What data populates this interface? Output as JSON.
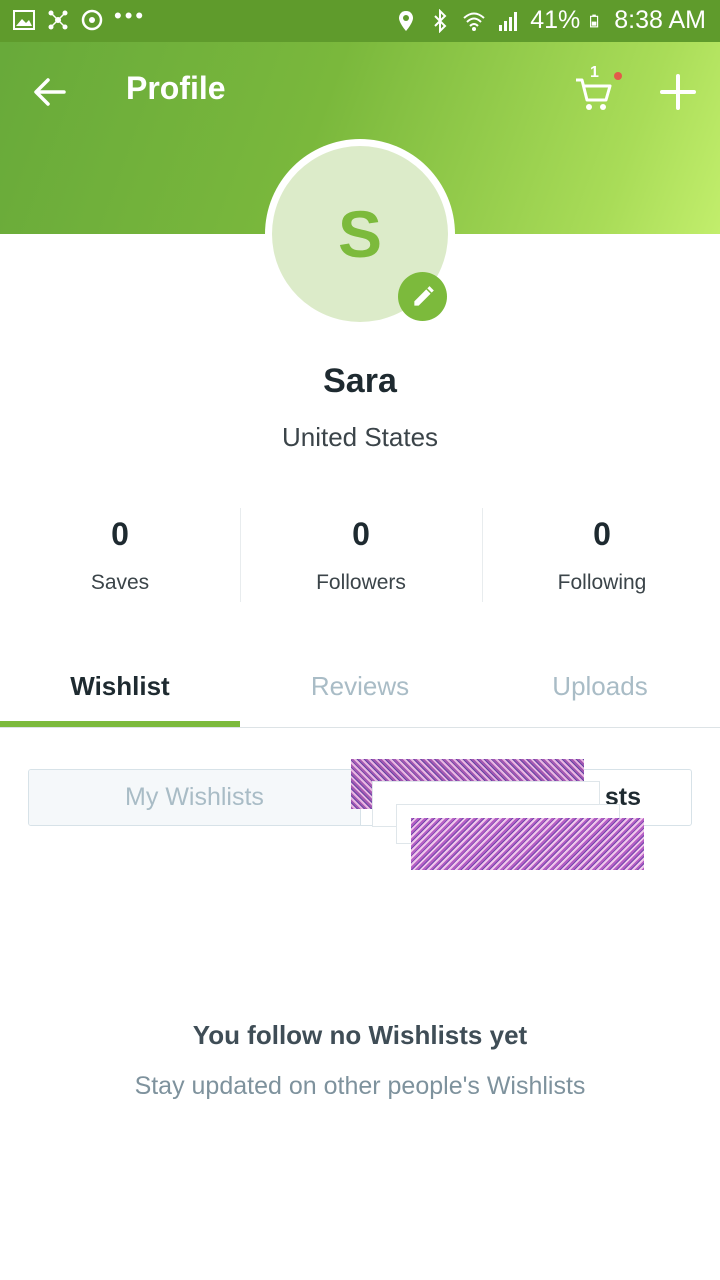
{
  "status_bar": {
    "battery": "41%",
    "time": "8:38 AM",
    "icons": [
      "image-icon",
      "network-icon",
      "sync-icon",
      "more-icon",
      "location-icon",
      "bluetooth-icon",
      "wifi-icon",
      "signal-icon",
      "battery-icon"
    ]
  },
  "toolbar": {
    "title": "Profile",
    "cart_count": "1",
    "accent": "#7cba3c"
  },
  "profile": {
    "avatar_letter": "S",
    "name": "Sara",
    "location": "United States"
  },
  "stats": [
    {
      "value": "0",
      "label": "Saves"
    },
    {
      "value": "0",
      "label": "Followers"
    },
    {
      "value": "0",
      "label": "Following"
    }
  ],
  "tabs": [
    {
      "label": "Wishlist",
      "active": true
    },
    {
      "label": "Reviews",
      "active": false
    },
    {
      "label": "Uploads",
      "active": false
    }
  ],
  "segments": {
    "left": "My Wishlists",
    "right_visible": "sts"
  },
  "empty_state": {
    "title": "You follow no Wishlists yet",
    "subtitle": "Stay updated on other people's Wishlists"
  }
}
